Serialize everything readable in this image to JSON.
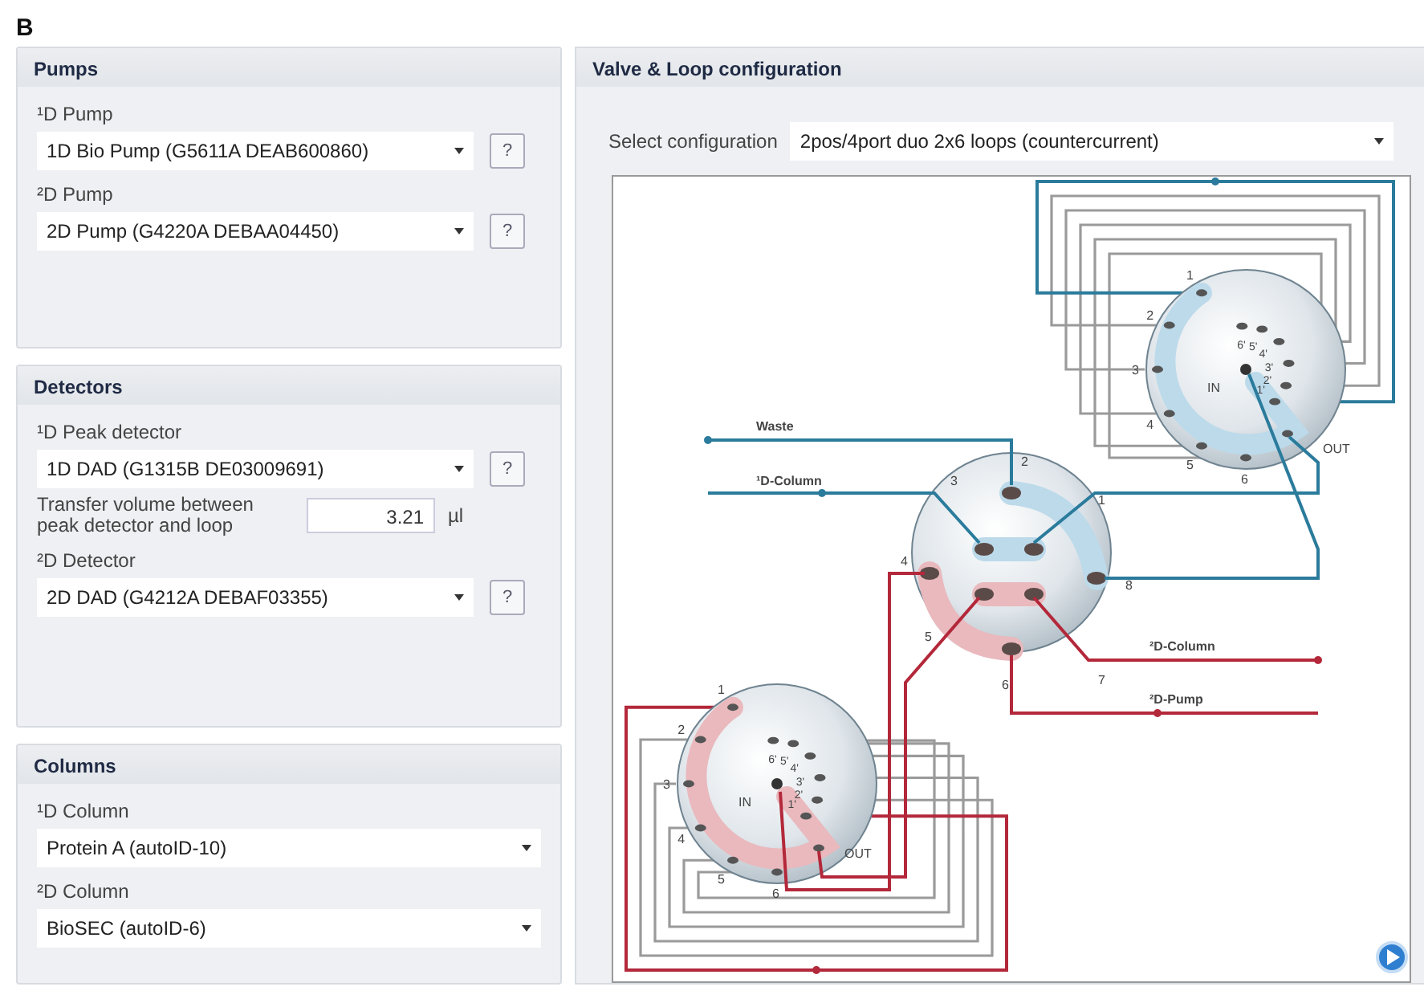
{
  "figure_label": "B",
  "sections": [
    {
      "title": "Pumps",
      "fields": [
        {
          "kind": "select",
          "label": "¹D Pump",
          "value": "1D Bio Pump (G5611A DEAB600860)",
          "help": "?"
        },
        {
          "kind": "select",
          "label": "²D Pump",
          "value": "2D Pump (G4220A DEBAA04450)",
          "help": "?"
        }
      ]
    },
    {
      "title": "Detectors",
      "fields": [
        {
          "kind": "select",
          "label": "¹D Peak detector",
          "value": "1D DAD (G1315B DE03009691)",
          "help": "?"
        },
        {
          "kind": "number",
          "label": "Transfer volume between peak detector and loop",
          "value": "3.21",
          "unit": "µl"
        },
        {
          "kind": "select",
          "label": "²D Detector",
          "value": "2D DAD (G4212A DEBAF03355)",
          "help": "?"
        }
      ]
    },
    {
      "title": "Columns",
      "fields": [
        {
          "kind": "select",
          "label": "¹D Column",
          "value": "Protein A (autoID-10)"
        },
        {
          "kind": "select",
          "label": "²D Column",
          "value": "BioSEC (autoID-6)"
        }
      ]
    }
  ],
  "valve_panel": {
    "title": "Valve &  Loop configuration",
    "select_label": "Select configuration",
    "select_value": "2pos/4port duo 2x6 loops (countercurrent)",
    "diagram": {
      "lines": [
        {
          "label": "Waste",
          "color": "#2b7b9c"
        },
        {
          "label": "¹D-Column",
          "color": "#2b7b9c"
        },
        {
          "label": "²D-Column",
          "color": "#b3283a"
        },
        {
          "label": "²D-Pump",
          "color": "#b3283a"
        }
      ],
      "switch_valve": {
        "ports": [
          "1",
          "2",
          "3",
          "4",
          "5",
          "6",
          "7",
          "8"
        ]
      },
      "selector_valves": [
        {
          "color": "#2b7b9c",
          "ports": [
            "1",
            "2",
            "3",
            "4",
            "5",
            "6"
          ],
          "inner_ports": [
            "6'",
            "5'",
            "4'",
            "3'",
            "2'",
            "1'"
          ],
          "inlet": "IN",
          "outlet": "OUT"
        },
        {
          "color": "#b3283a",
          "ports": [
            "1",
            "2",
            "3",
            "4",
            "5",
            "6"
          ],
          "inner_ports": [
            "6'",
            "5'",
            "4'",
            "3'",
            "2'",
            "1'"
          ],
          "inlet": "IN",
          "outlet": "OUT"
        }
      ]
    }
  }
}
